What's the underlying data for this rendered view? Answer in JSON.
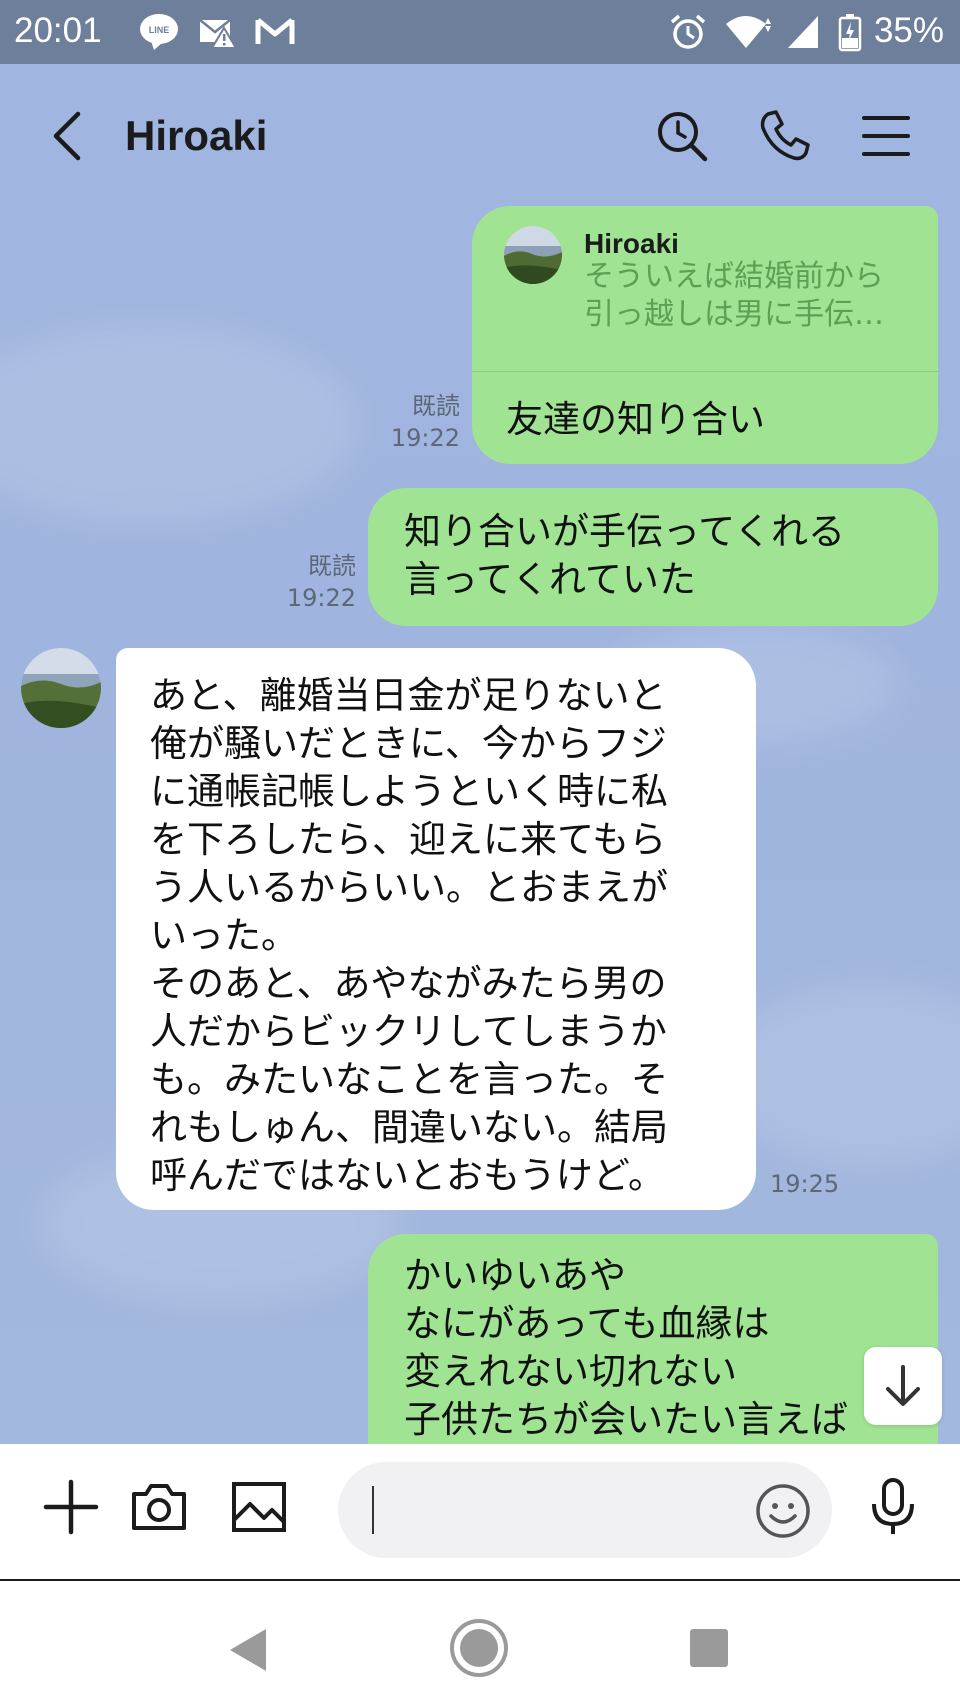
{
  "status_bar": {
    "time": "20:01",
    "battery": "35%",
    "icons": [
      "line-notification-icon",
      "mail-warning-icon",
      "gmail-icon",
      "alarm-icon",
      "wifi-icon",
      "signal-icon",
      "battery-icon"
    ]
  },
  "header": {
    "title": "Hiroaki",
    "icons": [
      "back-arrow-icon",
      "search-clock-icon",
      "phone-icon",
      "menu-icon"
    ]
  },
  "messages": [
    {
      "side": "right",
      "reply_to": {
        "name": "Hiroaki",
        "line1": "そういえば結婚前から",
        "line2": "引っ越しは男に手伝…"
      },
      "text": "友達の知り合い",
      "read": "既読",
      "time": "19:22"
    },
    {
      "side": "right",
      "line1": "知り合いが手伝ってくれる",
      "line2": "言ってくれていた",
      "read": "既読",
      "time": "19:22"
    },
    {
      "side": "left",
      "lines": [
        "あと、離婚当日金が足りないと",
        "俺が騒いだときに、今からフジ",
        "に通帳記帳しようといく時に私",
        "を下ろしたら、迎えに来てもら",
        "う人いるからいい。とおまえが",
        "いった。",
        "そのあと、あやながみたら男の",
        "人だからビックリしてしまうか",
        "も。みたいなことを言った。そ",
        "れもしゅん、間違いない。結局",
        "呼んだではないとおもうけど。"
      ],
      "time": "19:25"
    },
    {
      "side": "right",
      "lines": [
        "かいゆいあや",
        "なにがあっても血縁は",
        "変えれない切れない",
        "子供たちが会いたい言えば"
      ]
    }
  ],
  "input": {
    "placeholder": "",
    "icons": [
      "plus-icon",
      "camera-icon",
      "image-icon",
      "emoji-icon",
      "microphone-icon"
    ]
  },
  "colors": {
    "status_bar": "#6e7f9c",
    "chat_bg": "#9eb4de",
    "bubble_mine": "#a0e393",
    "bubble_theirs": "#ffffff",
    "quote_text": "#5ea053"
  }
}
